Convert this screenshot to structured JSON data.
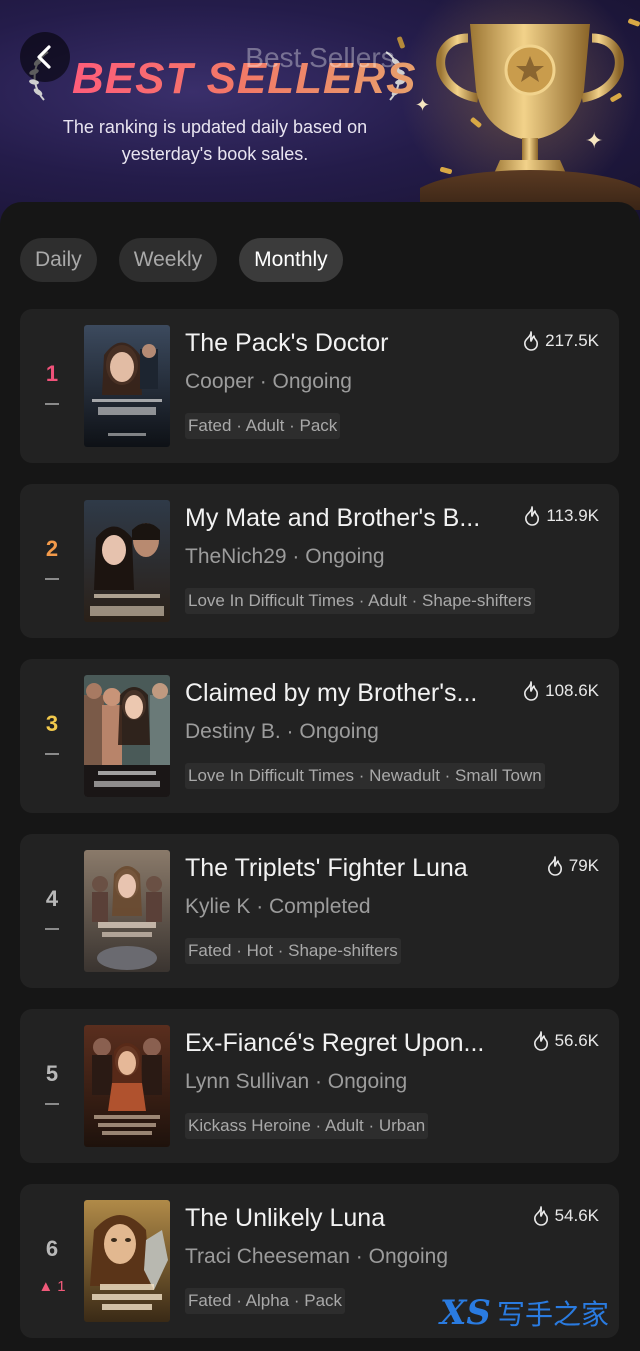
{
  "header": {
    "nav_title": "Best Sellers",
    "banner_title": "BEST SELLERS",
    "subtitle": "The ranking is updated daily based on yesterday's book sales."
  },
  "tabs": [
    {
      "label": "Daily",
      "active": false
    },
    {
      "label": "Weekly",
      "active": false
    },
    {
      "label": "Monthly",
      "active": true
    }
  ],
  "books": [
    {
      "rank": "1",
      "rank_color": "#f0527a",
      "trend": "none",
      "title": "The Pack's Doctor",
      "meta": "Cooper · Ongoing",
      "tags": "Fated · Adult · Pack",
      "heat": "217.5K"
    },
    {
      "rank": "2",
      "rank_color": "#f39a4a",
      "trend": "none",
      "title": "My Mate and Brother's B...",
      "meta": "TheNich29 · Ongoing",
      "tags": "Love In Difficult Times · Adult · Shape-shifters",
      "heat": "113.9K"
    },
    {
      "rank": "3",
      "rank_color": "#f2c94c",
      "trend": "none",
      "title": "Claimed by my Brother's...",
      "meta": "Destiny B. · Ongoing",
      "tags": "Love In Difficult Times · Newadult · Small Town",
      "heat": "108.6K"
    },
    {
      "rank": "4",
      "rank_color": "#b8b8b8",
      "trend": "none",
      "title": "The Triplets' Fighter Luna",
      "meta": "Kylie K · Completed",
      "tags": "Fated · Hot · Shape-shifters",
      "heat": "79K"
    },
    {
      "rank": "5",
      "rank_color": "#b8b8b8",
      "trend": "none",
      "title": "Ex-Fiancé's Regret Upon...",
      "meta": "Lynn Sullivan · Ongoing",
      "tags": "Kickass Heroine · Adult · Urban",
      "heat": "56.6K"
    },
    {
      "rank": "6",
      "rank_color": "#b8b8b8",
      "trend": "up",
      "trend_value": "1",
      "title": "The Unlikely Luna",
      "meta": "Traci Cheeseman · Ongoing",
      "tags": "Fated · Alpha · Pack",
      "heat": "54.6K"
    }
  ],
  "watermark": {
    "logo": "XS",
    "text": "写手之家"
  }
}
